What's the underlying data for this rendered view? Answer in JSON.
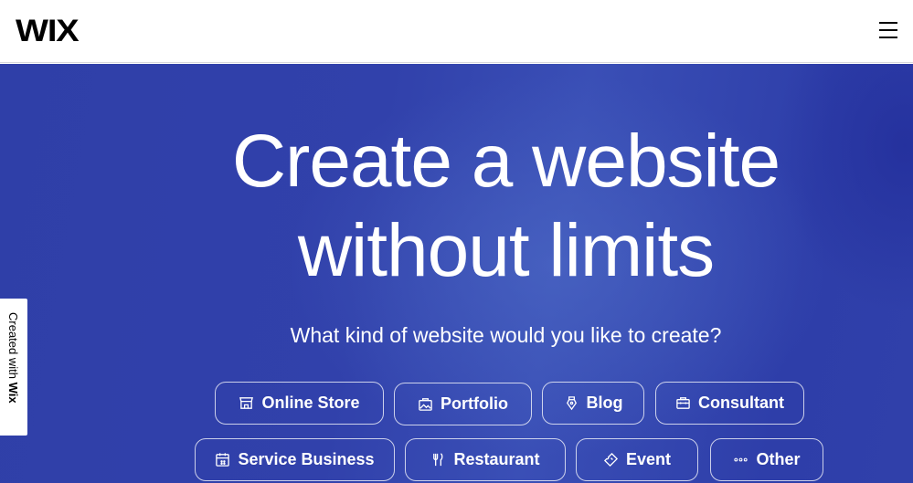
{
  "header": {
    "logo_text": "WIX",
    "menu_icon": "hamburger-menu-icon"
  },
  "hero": {
    "headline_line1": "Create a website",
    "headline_line2": "without limits",
    "subheadline": "What kind of website would you like to create?",
    "background_color": "#3141ab",
    "categories": [
      {
        "label": "Online Store",
        "icon": "storefront-icon"
      },
      {
        "label": "Portfolio",
        "icon": "portfolio-image-icon"
      },
      {
        "label": "Blog",
        "icon": "pen-nib-icon"
      },
      {
        "label": "Consultant",
        "icon": "briefcase-icon"
      },
      {
        "label": "Service Business",
        "icon": "calendar-icon"
      },
      {
        "label": "Restaurant",
        "icon": "fork-knife-icon"
      },
      {
        "label": "Event",
        "icon": "ticket-icon"
      },
      {
        "label": "Other",
        "icon": "more-dots-icon"
      }
    ]
  },
  "badge": {
    "prefix": "Created with ",
    "brand": "Wix"
  }
}
